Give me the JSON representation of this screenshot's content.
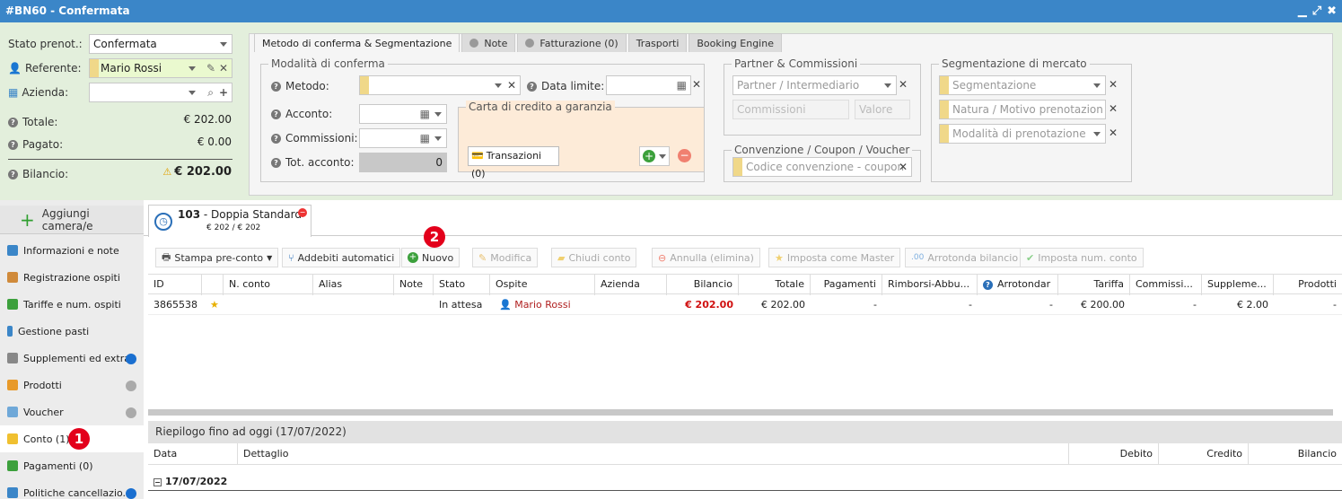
{
  "window": {
    "title": "#BN60 - Confermata"
  },
  "left": {
    "stato_label": "Stato prenot.:",
    "stato_value": "Confermata",
    "referente_label": "Referente:",
    "referente_value": "Mario Rossi",
    "azienda_label": "Azienda:",
    "totale_label": "Totale:",
    "totale_value": "€ 202.00",
    "pagato_label": "Pagato:",
    "pagato_value": "€ 0.00",
    "bilancio_label": "Bilancio:",
    "bilancio_value": "€ 202.00"
  },
  "tabs": [
    {
      "label": "Metodo di conferma & Segmentazione"
    },
    {
      "label": "Note"
    },
    {
      "label": "Fatturazione (0)"
    },
    {
      "label": "Trasporti"
    },
    {
      "label": "Booking Engine"
    }
  ],
  "modalita": {
    "legend": "Modalità di conferma",
    "metodo_label": "Metodo:",
    "data_limite_label": "Data limite:",
    "acconto_label": "Acconto:",
    "commissioni_label": "Commissioni:",
    "tot_acconto_label": "Tot. acconto:",
    "tot_acconto_value": "0",
    "carta_legend": "Carta di credito a garanzia",
    "transazioni_label": "Transazioni (0)"
  },
  "partner": {
    "legend": "Partner & Commissioni",
    "partner_ph": "Partner / Intermediario",
    "commissioni_ph": "Commissioni",
    "valore_ph": "Valore"
  },
  "convenzione": {
    "legend": "Convenzione / Coupon / Voucher",
    "codice_ph": "Codice convenzione - coupon"
  },
  "segmentazione": {
    "legend": "Segmentazione di mercato",
    "seg_ph": "Segmentazione",
    "natura_ph": "Natura / Motivo prenotazion",
    "modalita_ph": "Modalità di prenotazione"
  },
  "sidebar": {
    "add_label": "Aggiungi camera/e",
    "items": [
      {
        "label": "Informazioni e note"
      },
      {
        "label": "Registrazione ospiti"
      },
      {
        "label": "Tariffe e num. ospiti"
      },
      {
        "label": "Gestione pasti"
      },
      {
        "label": "Supplementi ed extra"
      },
      {
        "label": "Prodotti"
      },
      {
        "label": "Voucher"
      },
      {
        "label": "Conto (1)"
      },
      {
        "label": "Pagamenti (0)"
      },
      {
        "label": "Politiche cancellazio..."
      }
    ]
  },
  "room": {
    "number": "103",
    "sep": " - ",
    "name": "Doppia Standard",
    "price": "€ 202 / € 202"
  },
  "toolbar": {
    "stampa": "Stampa pre-conto",
    "addebiti": "Addebiti automatici",
    "nuovo": "Nuovo",
    "modifica": "Modifica",
    "chiudi": "Chiudi conto",
    "annulla": "Annulla (elimina)",
    "master": "Imposta come Master",
    "arrotonda": "Arrotonda bilancio",
    "numconto": "Imposta num. conto"
  },
  "grid": {
    "headers": [
      "ID",
      "",
      "N. conto",
      "Alias",
      "Note",
      "Stato",
      "Ospite",
      "Azienda",
      "Bilancio",
      "Totale",
      "Pagamenti",
      "Rimborsi-Abbu...",
      "Arrotondar",
      "Tariffa",
      "Commissi...",
      "Suppleme...",
      "Prodotti"
    ],
    "row": {
      "id": "3865538",
      "stato": "In attesa",
      "ospite": "Mario Rossi",
      "bilancio": "€ 202.00",
      "totale": "€ 202.00",
      "pagamenti": "-",
      "rimborsi": "-",
      "arrot": "-",
      "tariffa": "€ 200.00",
      "commiss": "-",
      "supplem": "€ 2.00",
      "prodotti": "-"
    }
  },
  "summary": {
    "title": "Riepilogo fino ad oggi (17/07/2022)",
    "headers": [
      "Data",
      "Dettaglio",
      "Debito",
      "Credito",
      "Bilancio"
    ],
    "group": "17/07/2022"
  },
  "badges": [
    "1",
    "2"
  ]
}
